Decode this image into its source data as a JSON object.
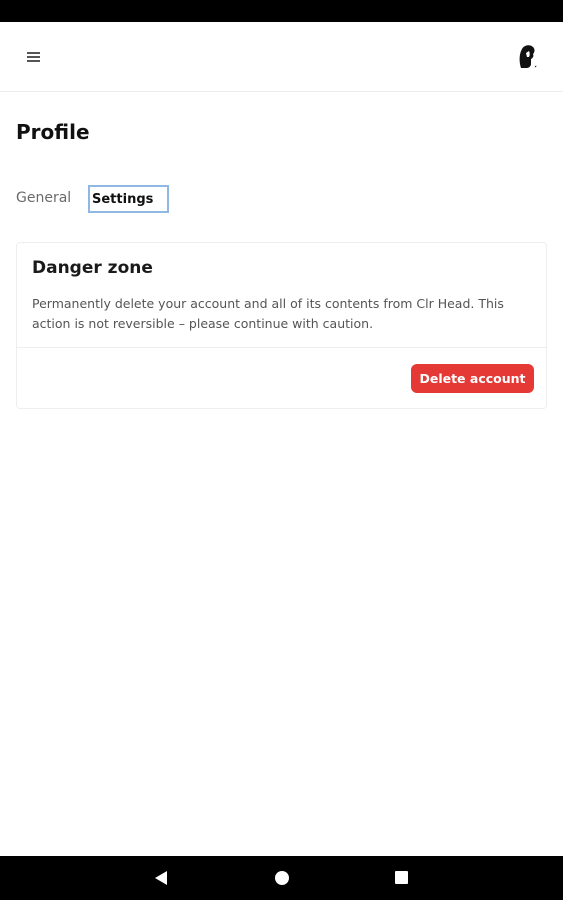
{
  "header": {
    "menu_icon": "hamburger-menu-icon",
    "avatar_icon": "user-avatar"
  },
  "page": {
    "title": "Profile"
  },
  "tabs": [
    {
      "label": "General",
      "active": false
    },
    {
      "label": "Settings",
      "active": true
    }
  ],
  "danger_zone": {
    "title": "Danger zone",
    "description": "Permanently delete your account and all of its contents from Clr Head. This action is not reversible – please continue with caution.",
    "delete_label": "Delete account",
    "delete_color": "#e53935"
  },
  "system_nav": {
    "back_icon": "back-triangle-icon",
    "home_icon": "home-circle-icon",
    "recents_icon": "recents-square-icon"
  }
}
